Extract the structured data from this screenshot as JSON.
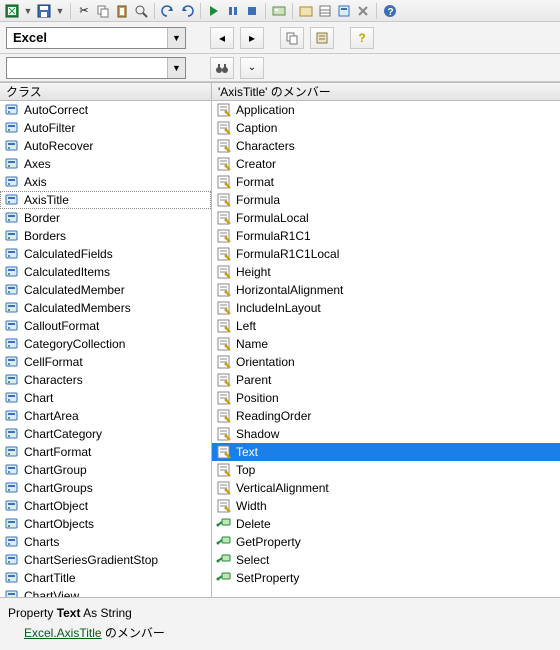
{
  "toolbar": {
    "library_combo_value": "Excel",
    "search_combo_value": "",
    "buttons": {
      "nav_back": "◂",
      "nav_forward": "▸",
      "copy": "",
      "paste": "",
      "help": "?",
      "find": "",
      "options": "▾"
    }
  },
  "panes": {
    "classes_header": "クラス",
    "members_header": "'AxisTitle' のメンバー"
  },
  "classes": [
    {
      "name": "AutoCorrect",
      "kind": "class"
    },
    {
      "name": "AutoFilter",
      "kind": "class"
    },
    {
      "name": "AutoRecover",
      "kind": "class"
    },
    {
      "name": "Axes",
      "kind": "class"
    },
    {
      "name": "Axis",
      "kind": "class"
    },
    {
      "name": "AxisTitle",
      "kind": "class",
      "selected": true
    },
    {
      "name": "Border",
      "kind": "class"
    },
    {
      "name": "Borders",
      "kind": "class"
    },
    {
      "name": "CalculatedFields",
      "kind": "class"
    },
    {
      "name": "CalculatedItems",
      "kind": "class"
    },
    {
      "name": "CalculatedMember",
      "kind": "class"
    },
    {
      "name": "CalculatedMembers",
      "kind": "class"
    },
    {
      "name": "CalloutFormat",
      "kind": "class"
    },
    {
      "name": "CategoryCollection",
      "kind": "class"
    },
    {
      "name": "CellFormat",
      "kind": "class"
    },
    {
      "name": "Characters",
      "kind": "class"
    },
    {
      "name": "Chart",
      "kind": "class"
    },
    {
      "name": "ChartArea",
      "kind": "class"
    },
    {
      "name": "ChartCategory",
      "kind": "class"
    },
    {
      "name": "ChartFormat",
      "kind": "class"
    },
    {
      "name": "ChartGroup",
      "kind": "class"
    },
    {
      "name": "ChartGroups",
      "kind": "class"
    },
    {
      "name": "ChartObject",
      "kind": "class"
    },
    {
      "name": "ChartObjects",
      "kind": "class"
    },
    {
      "name": "Charts",
      "kind": "class"
    },
    {
      "name": "ChartSeriesGradientStop",
      "kind": "class"
    },
    {
      "name": "ChartTitle",
      "kind": "class"
    },
    {
      "name": "ChartView",
      "kind": "class"
    }
  ],
  "members": [
    {
      "name": "Application",
      "kind": "property"
    },
    {
      "name": "Caption",
      "kind": "property"
    },
    {
      "name": "Characters",
      "kind": "property"
    },
    {
      "name": "Creator",
      "kind": "property"
    },
    {
      "name": "Format",
      "kind": "property"
    },
    {
      "name": "Formula",
      "kind": "property"
    },
    {
      "name": "FormulaLocal",
      "kind": "property"
    },
    {
      "name": "FormulaR1C1",
      "kind": "property"
    },
    {
      "name": "FormulaR1C1Local",
      "kind": "property"
    },
    {
      "name": "Height",
      "kind": "property"
    },
    {
      "name": "HorizontalAlignment",
      "kind": "property"
    },
    {
      "name": "IncludeInLayout",
      "kind": "property"
    },
    {
      "name": "Left",
      "kind": "property"
    },
    {
      "name": "Name",
      "kind": "property"
    },
    {
      "name": "Orientation",
      "kind": "property"
    },
    {
      "name": "Parent",
      "kind": "property"
    },
    {
      "name": "Position",
      "kind": "property"
    },
    {
      "name": "ReadingOrder",
      "kind": "property"
    },
    {
      "name": "Shadow",
      "kind": "property"
    },
    {
      "name": "Text",
      "kind": "property",
      "selected": true
    },
    {
      "name": "Top",
      "kind": "property"
    },
    {
      "name": "VerticalAlignment",
      "kind": "property"
    },
    {
      "name": "Width",
      "kind": "property"
    },
    {
      "name": "Delete",
      "kind": "method"
    },
    {
      "name": "GetProperty",
      "kind": "method"
    },
    {
      "name": "Select",
      "kind": "method"
    },
    {
      "name": "SetProperty",
      "kind": "method"
    }
  ],
  "description": {
    "decl_prefix": "Property ",
    "decl_name": "Text",
    "decl_suffix": " As String",
    "link_text": "Excel.AxisTitle",
    "member_suffix": " のメンバー"
  }
}
